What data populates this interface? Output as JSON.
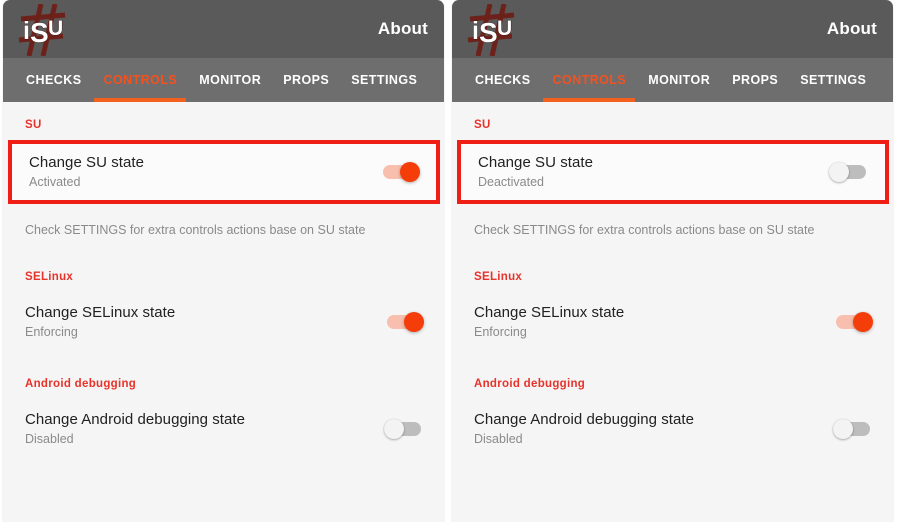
{
  "app": {
    "logo_text": "iSU",
    "logo_alt": "isu-logo",
    "about_label": "About"
  },
  "colors": {
    "appbar_bg": "#5a5a5a",
    "tabbar_bg": "#6e6e6e",
    "accent_orange": "#f4601e",
    "section_red": "#e8322a",
    "highlight_red": "#f01f16",
    "toggle_on_thumb": "#f43d09",
    "toggle_on_track": "#f9bfae",
    "toggle_off_track": "#bdbdbd",
    "toggle_off_thumb": "#f3f3f3",
    "content_bg": "#f5f5f5"
  },
  "tabs": [
    {
      "label": "CHECKS",
      "active": false
    },
    {
      "label": "CONTROLS",
      "active": true
    },
    {
      "label": "MONITOR",
      "active": false
    },
    {
      "label": "PROPS",
      "active": false
    },
    {
      "label": "SETTINGS",
      "active": false
    }
  ],
  "panels": [
    {
      "id": "left",
      "sections": [
        {
          "header": "SU"
        },
        {
          "highlighted": true,
          "title": "Change SU state",
          "subtitle": "Activated",
          "toggle": "on"
        },
        {
          "hint": "Check SETTINGS for extra controls actions base on SU state"
        },
        {
          "header": "SELinux"
        },
        {
          "highlighted": false,
          "title": "Change SELinux state",
          "subtitle": "Enforcing",
          "toggle": "on"
        },
        {
          "header": "Android debugging"
        },
        {
          "highlighted": false,
          "title": "Change Android debugging state",
          "subtitle": "Disabled",
          "toggle": "off"
        }
      ]
    },
    {
      "id": "right",
      "sections": [
        {
          "header": "SU"
        },
        {
          "highlighted": true,
          "title": "Change SU state",
          "subtitle": "Deactivated",
          "toggle": "off"
        },
        {
          "hint": "Check SETTINGS for extra controls actions base on SU state"
        },
        {
          "header": "SELinux"
        },
        {
          "highlighted": false,
          "title": "Change SELinux state",
          "subtitle": "Enforcing",
          "toggle": "on"
        },
        {
          "header": "Android debugging"
        },
        {
          "highlighted": false,
          "title": "Change Android debugging state",
          "subtitle": "Disabled",
          "toggle": "off"
        }
      ]
    }
  ]
}
